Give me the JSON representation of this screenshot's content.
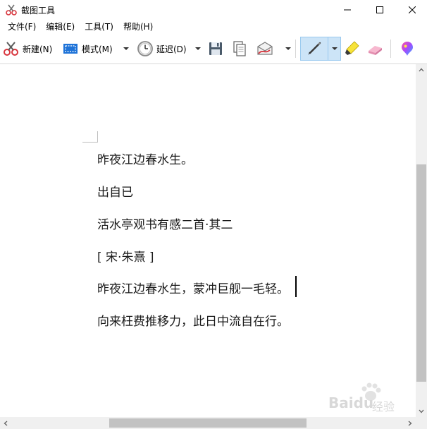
{
  "window": {
    "title": "截图工具",
    "app_icon": "scissors-icon",
    "controls": [
      "minimize-icon",
      "maximize-icon",
      "close-icon"
    ]
  },
  "menu": {
    "items": [
      {
        "label": "文件(F)"
      },
      {
        "label": "编辑(E)"
      },
      {
        "label": "工具(T)"
      },
      {
        "label": "帮助(H)"
      }
    ]
  },
  "toolbar": {
    "new_label": "新建(N)",
    "mode_label": "模式(M)",
    "delay_label": "延迟(D)",
    "icons": {
      "new": "scissors-icon",
      "mode": "rectangle-snip-icon",
      "delay": "clock-icon",
      "save": "save-icon",
      "copy": "copy-icon",
      "send": "email-icon",
      "pen": "pen-icon",
      "highlighter": "highlighter-icon",
      "eraser": "eraser-icon",
      "paint3d": "paint3d-icon"
    },
    "selected_tool": "pen",
    "accent_color": "#cce4f7"
  },
  "document": {
    "lines": [
      "昨夜江边春水生。",
      "出自已",
      "活水亭观书有感二首·其二",
      "[ 宋·朱熹 ]",
      "昨夜江边春水生，蒙冲巨舰一毛轻。",
      "向来枉费推移力，此日中流自在行。"
    ]
  },
  "watermark": {
    "text": "Baidu",
    "sub": "经验"
  }
}
